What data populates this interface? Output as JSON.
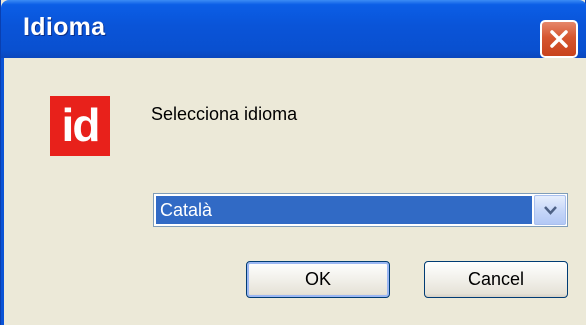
{
  "window": {
    "title": "Idioma"
  },
  "dialog": {
    "logo_text": "id",
    "prompt": "Selecciona idioma",
    "language_select": {
      "selected": "Català"
    },
    "ok_label": "OK",
    "cancel_label": "Cancel"
  },
  "colors": {
    "titlebar": "#0a54d8",
    "logo_bg": "#e8211b",
    "selection": "#316ac5",
    "close_button": "#d6552f"
  },
  "icons": {
    "close": "close-icon",
    "dropdown": "chevron-down-icon"
  }
}
